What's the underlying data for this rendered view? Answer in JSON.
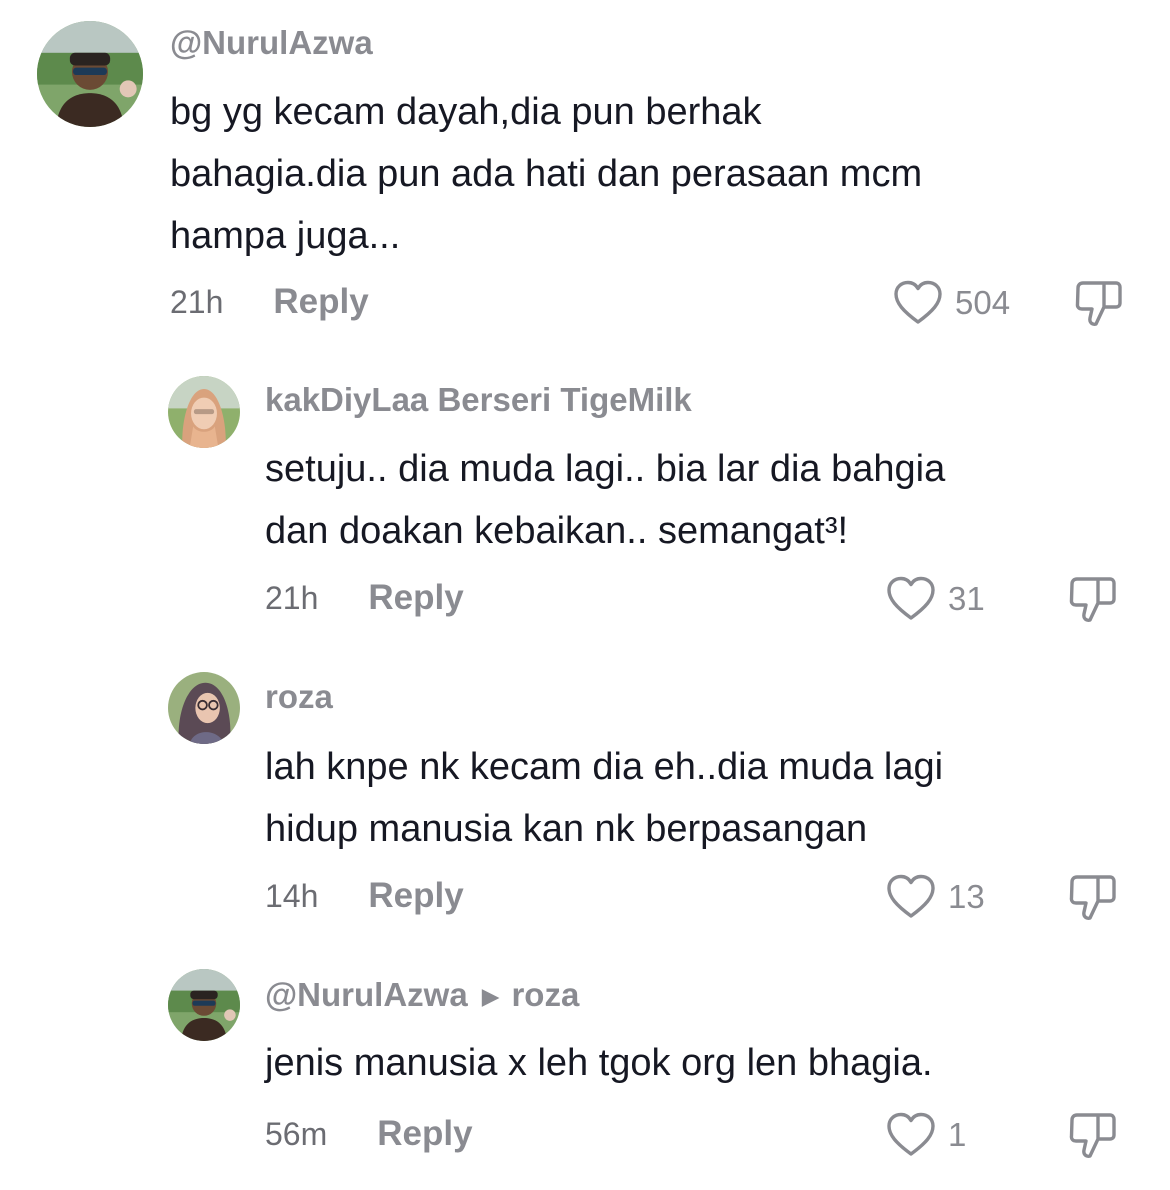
{
  "comments": [
    {
      "username": "@NurulAzwa",
      "text": "bg yg kecam dayah,dia pun berhak\nbahagia.dia pun ada hati dan perasaan mcm\nhampa juga...",
      "time": "21h",
      "reply_label": "Reply",
      "likes": "504",
      "avatar": "man-sunglasses-avatar"
    },
    {
      "username": "kakDiyLaa Berseri TigeMilk",
      "text": "setuju.. dia muda lagi.. bia lar dia bahgia\ndan doakan kebaikan.. semangat³!",
      "time": "21h",
      "reply_label": "Reply",
      "likes": "31",
      "avatar": "hijab-woman-avatar"
    },
    {
      "username": "roza",
      "text": "lah knpe nk kecam dia eh..dia muda lagi\nhidup manusia kan nk berpasangan",
      "time": "14h",
      "reply_label": "Reply",
      "likes": "13",
      "avatar": "hijab-glasses-avatar"
    },
    {
      "username": "@NurulAzwa",
      "reply_to": "roza",
      "text": "jenis manusia x leh tgok org len bhagia.",
      "time": "56m",
      "reply_label": "Reply",
      "likes": "1",
      "avatar": "man-sunglasses-avatar"
    }
  ],
  "icons": {
    "like": "heart-outline-icon",
    "dislike": "thumbs-down-icon",
    "reply_arrow": "triangle-right-icon"
  },
  "colors": {
    "text": "#161823",
    "muted": "#8a8b91",
    "background": "#ffffff"
  }
}
